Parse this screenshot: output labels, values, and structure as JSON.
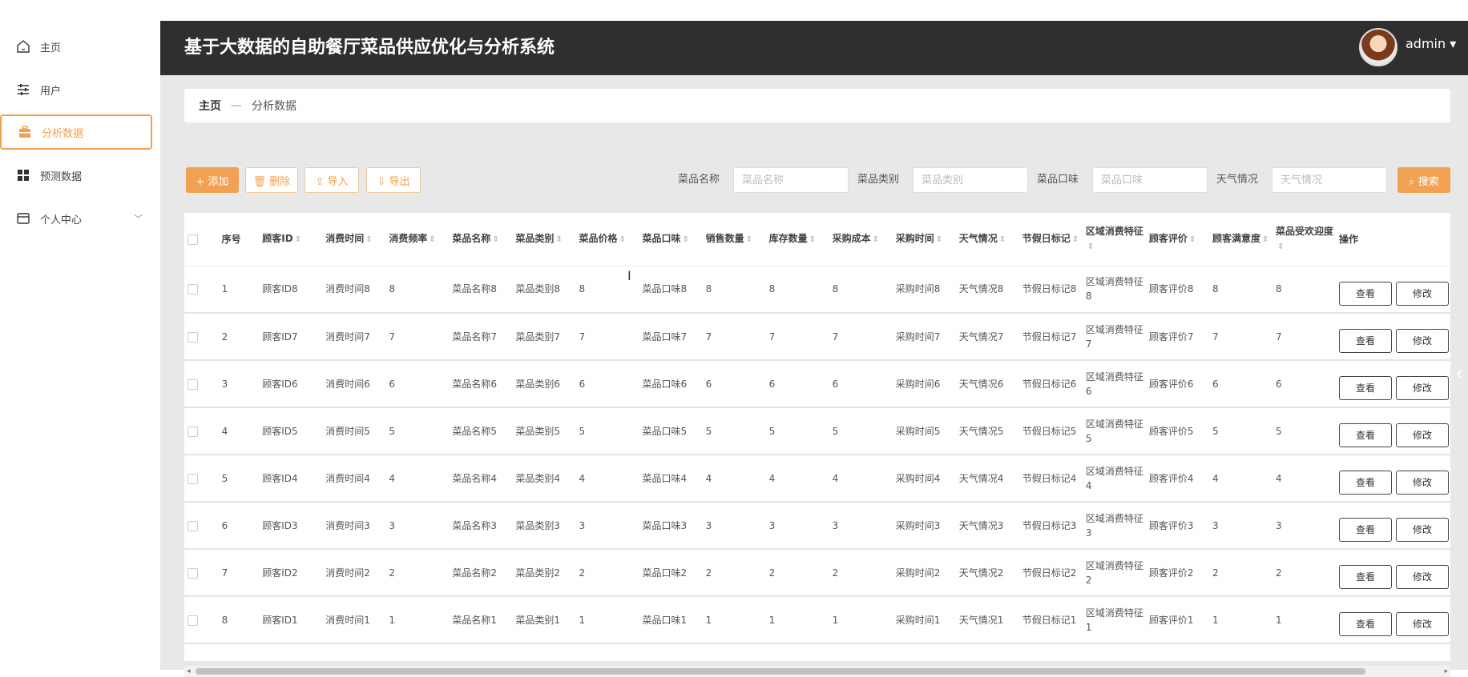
{
  "app": {
    "title": "基于大数据的自助餐厅菜品供应优化与分析系统",
    "user": "admin ▾"
  },
  "sidebar": {
    "items": [
      {
        "label": "主页",
        "icon": "home-icon"
      },
      {
        "label": "用户",
        "icon": "sliders-icon"
      },
      {
        "label": "分析数据",
        "icon": "briefcase-icon"
      },
      {
        "label": "预测数据",
        "icon": "grid-icon"
      },
      {
        "label": "个人中心",
        "icon": "card-icon",
        "chevron": "﹀"
      }
    ]
  },
  "breadcrumb": {
    "home": "主页",
    "sep": "—",
    "current": "分析数据"
  },
  "toolbar": {
    "add": "+ 添加",
    "delete": "🗑 删除",
    "import": "⇪ 导入",
    "export": "⇩ 导出",
    "search": "⌕ 搜索"
  },
  "filters": [
    {
      "label": "菜品名称",
      "placeholder": "菜品名称"
    },
    {
      "label": "菜品类别",
      "placeholder": "菜品类别"
    },
    {
      "label": "菜品口味",
      "placeholder": "菜品口味"
    },
    {
      "label": "天气情况",
      "placeholder": "天气情况"
    }
  ],
  "table": {
    "columns": [
      "序号",
      "顾客ID",
      "消费时间",
      "消费频率",
      "菜品名称",
      "菜品类别",
      "菜品价格",
      "菜品口味",
      "销售数量",
      "库存数量",
      "采购成本",
      "采购时间",
      "天气情况",
      "节假日标记",
      "区域消费特征",
      "顾客评价",
      "顾客满意度",
      "菜品受欢迎度",
      "操作"
    ],
    "rows": [
      [
        "1",
        "顾客ID8",
        "消费时间8",
        "8",
        "菜品名称8",
        "菜品类别8",
        "8",
        "菜品口味8",
        "8",
        "8",
        "8",
        "采购时间8",
        "天气情况8",
        "节假日标记8",
        "区域消费特征8",
        "顾客评价8",
        "8",
        "8"
      ],
      [
        "2",
        "顾客ID7",
        "消费时间7",
        "7",
        "菜品名称7",
        "菜品类别7",
        "7",
        "菜品口味7",
        "7",
        "7",
        "7",
        "采购时间7",
        "天气情况7",
        "节假日标记7",
        "区域消费特征7",
        "顾客评价7",
        "7",
        "7"
      ],
      [
        "3",
        "顾客ID6",
        "消费时间6",
        "6",
        "菜品名称6",
        "菜品类别6",
        "6",
        "菜品口味6",
        "6",
        "6",
        "6",
        "采购时间6",
        "天气情况6",
        "节假日标记6",
        "区域消费特征6",
        "顾客评价6",
        "6",
        "6"
      ],
      [
        "4",
        "顾客ID5",
        "消费时间5",
        "5",
        "菜品名称5",
        "菜品类别5",
        "5",
        "菜品口味5",
        "5",
        "5",
        "5",
        "采购时间5",
        "天气情况5",
        "节假日标记5",
        "区域消费特征5",
        "顾客评价5",
        "5",
        "5"
      ],
      [
        "5",
        "顾客ID4",
        "消费时间4",
        "4",
        "菜品名称4",
        "菜品类别4",
        "4",
        "菜品口味4",
        "4",
        "4",
        "4",
        "采购时间4",
        "天气情况4",
        "节假日标记4",
        "区域消费特征4",
        "顾客评价4",
        "4",
        "4"
      ],
      [
        "6",
        "顾客ID3",
        "消费时间3",
        "3",
        "菜品名称3",
        "菜品类别3",
        "3",
        "菜品口味3",
        "3",
        "3",
        "3",
        "采购时间3",
        "天气情况3",
        "节假日标记3",
        "区域消费特征3",
        "顾客评价3",
        "3",
        "3"
      ],
      [
        "7",
        "顾客ID2",
        "消费时间2",
        "2",
        "菜品名称2",
        "菜品类别2",
        "2",
        "菜品口味2",
        "2",
        "2",
        "2",
        "采购时间2",
        "天气情况2",
        "节假日标记2",
        "区域消费特征2",
        "顾客评价2",
        "2",
        "2"
      ],
      [
        "8",
        "顾客ID1",
        "消费时间1",
        "1",
        "菜品名称1",
        "菜品类别1",
        "1",
        "菜品口味1",
        "1",
        "1",
        "1",
        "采购时间1",
        "天气情况1",
        "节假日标记1",
        "区域消费特征1",
        "顾客评价1",
        "1",
        "1"
      ]
    ],
    "actions": {
      "view": "查看",
      "edit": "修改"
    }
  },
  "colors": {
    "accent": "#f0a152",
    "header": "#2f2f2f",
    "background": "#e8e8e8"
  }
}
